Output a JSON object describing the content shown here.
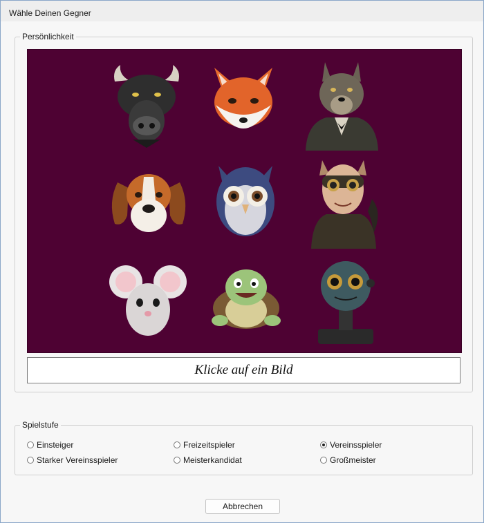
{
  "window": {
    "title": "Wähle Deinen Gegner"
  },
  "personality": {
    "legend": "Persönlichkeit",
    "prompt": "Klicke auf ein Bild",
    "portraits": [
      {
        "icon": "bull-icon"
      },
      {
        "icon": "fox-icon"
      },
      {
        "icon": "wolf-icon"
      },
      {
        "icon": "beagle-icon"
      },
      {
        "icon": "owl-icon"
      },
      {
        "icon": "cat-woman-icon"
      },
      {
        "icon": "mouse-icon"
      },
      {
        "icon": "turtle-icon"
      },
      {
        "icon": "robot-icon"
      }
    ]
  },
  "level": {
    "legend": "Spielstufe",
    "options": [
      {
        "label": "Einsteiger",
        "selected": false
      },
      {
        "label": "Freizeitspieler",
        "selected": false
      },
      {
        "label": "Vereinsspieler",
        "selected": true
      },
      {
        "label": "Starker Vereinsspieler",
        "selected": false
      },
      {
        "label": "Meisterkandidat",
        "selected": false
      },
      {
        "label": "Großmeister",
        "selected": false
      }
    ]
  },
  "buttons": {
    "cancel": "Abbrechen"
  },
  "colors": {
    "panel_bg": "#4e0233",
    "window_border": "#8aa6c8"
  }
}
